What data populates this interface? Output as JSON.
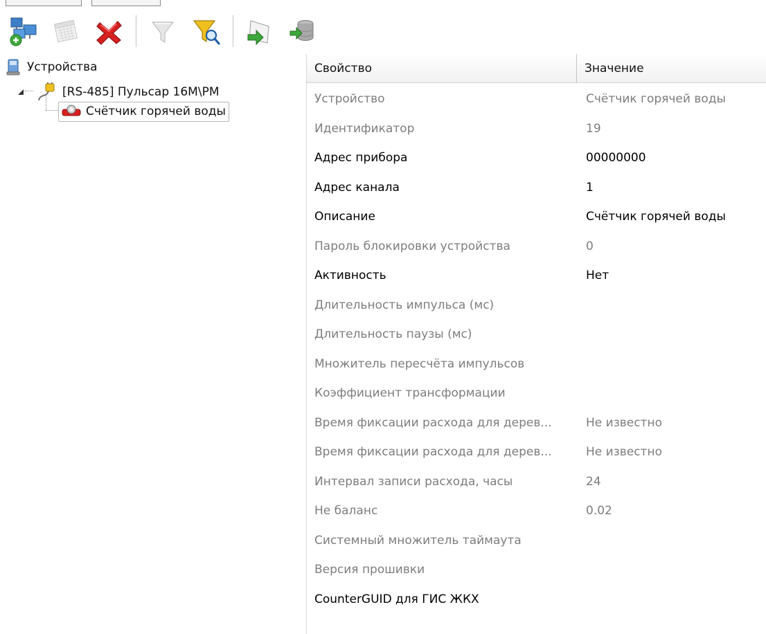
{
  "toolbar": {
    "buttons": [
      {
        "name": "add-device-button",
        "icon": "network-add-icon",
        "enabled": true
      },
      {
        "name": "calendar-button",
        "icon": "calendar-icon",
        "enabled": false
      },
      {
        "name": "delete-button",
        "icon": "red-x-icon",
        "enabled": true
      },
      {
        "name": "filter-button",
        "icon": "funnel-icon",
        "enabled": false
      },
      {
        "name": "filter-search-button",
        "icon": "funnel-magnifier-icon",
        "enabled": true
      },
      {
        "name": "export-button",
        "icon": "green-arrow-export-icon",
        "enabled": true
      },
      {
        "name": "database-import-button",
        "icon": "database-arrow-icon",
        "enabled": true
      }
    ]
  },
  "tree": {
    "root": {
      "label": "Устройства",
      "icon": "computer-devices-icon"
    },
    "child": {
      "label": "[RS-485] Пульсар 16М\\РМ",
      "icon": "cable-plug-icon"
    },
    "leaf": {
      "label": "Счётчик горячей воды",
      "icon": "water-meter-icon"
    }
  },
  "grid": {
    "columns": [
      "Свойство",
      "Значение"
    ],
    "rows": [
      {
        "property": "Устройство",
        "value": "Счётчик горячей воды",
        "editable": false
      },
      {
        "property": "Идентификатор",
        "value": "19",
        "editable": false
      },
      {
        "property": "Адрес прибора",
        "value": "00000000",
        "editable": true
      },
      {
        "property": "Адрес канала",
        "value": "1",
        "editable": true
      },
      {
        "property": "Описание",
        "value": "Счётчик горячей воды",
        "editable": true
      },
      {
        "property": "Пароль блокировки устройства",
        "value": "0",
        "editable": false
      },
      {
        "property": "Активность",
        "value": "Нет",
        "editable": true
      },
      {
        "property": "Длительность импульса (мс)",
        "value": "",
        "editable": false
      },
      {
        "property": "Длительность паузы (мс)",
        "value": "",
        "editable": false
      },
      {
        "property": "Множитель пересчёта импульсов",
        "value": "",
        "editable": false
      },
      {
        "property": "Коэффициент трансформации",
        "value": "",
        "editable": false
      },
      {
        "property": "Время фиксации расхода для дерев...",
        "value": "Не известно",
        "editable": false
      },
      {
        "property": "Время фиксации расхода для дерев...",
        "value": "Не известно",
        "editable": false
      },
      {
        "property": "Интервал записи расхода, часы",
        "value": "24",
        "editable": false
      },
      {
        "property": "Не баланс",
        "value": "0.02",
        "editable": false
      },
      {
        "property": "Системный множитель таймаута",
        "value": "",
        "editable": false
      },
      {
        "property": "Версия прошивки",
        "value": "",
        "editable": false
      },
      {
        "property": "CounterGUID для ГИС ЖКХ",
        "value": "",
        "editable": true
      }
    ]
  },
  "colors": {
    "readonly_text": "#7d7d7d",
    "editable_text": "#000000",
    "delete_red": "#d82020",
    "funnel_yellow": "#f0c020",
    "export_green": "#3ea83a"
  }
}
